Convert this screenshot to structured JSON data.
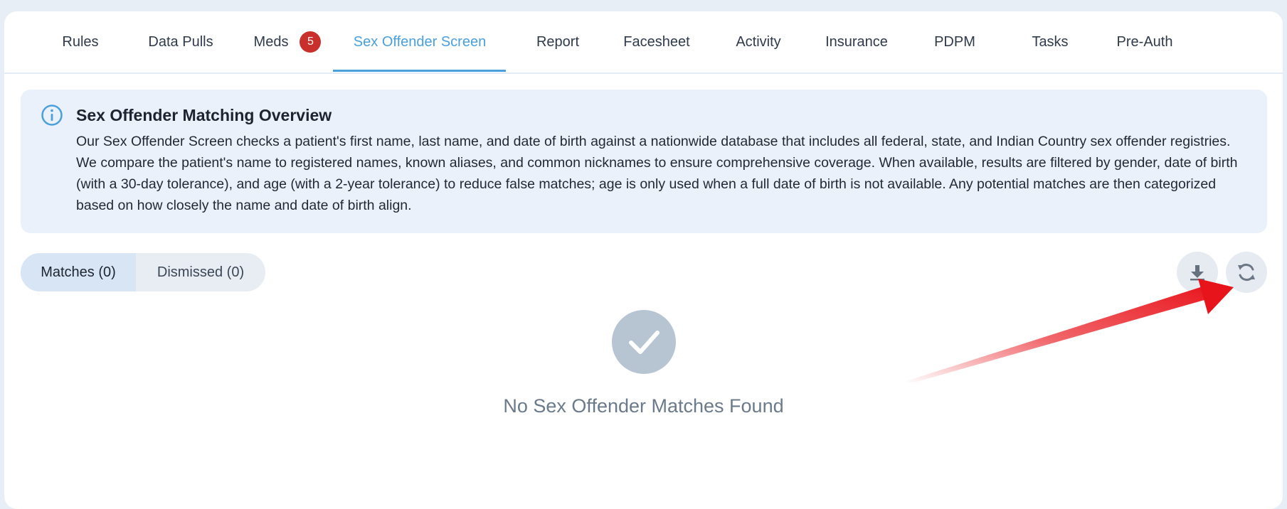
{
  "tabs": [
    {
      "label": "Rules"
    },
    {
      "label": "Data Pulls"
    },
    {
      "label": "Meds",
      "badge": "5"
    },
    {
      "label": "Sex Offender Screen",
      "active": true
    },
    {
      "label": "Report"
    },
    {
      "label": "Facesheet"
    },
    {
      "label": "Activity"
    },
    {
      "label": "Insurance"
    },
    {
      "label": "PDPM"
    },
    {
      "label": "Tasks"
    },
    {
      "label": "Pre-Auth"
    }
  ],
  "info": {
    "icon": "info-circle-icon",
    "title": "Sex Offender Matching Overview",
    "text": "Our Sex Offender Screen checks a patient's first name, last name, and date of birth against a nationwide database that includes all federal, state, and Indian Country sex offender registries. We compare the patient's name to registered names, known aliases, and common nicknames to ensure comprehensive coverage. When available, results are filtered by gender, date of birth (with a 30-day tolerance), and age (with a 2-year tolerance) to reduce false matches; age is only used when a full date of birth is not available. Any potential matches are then categorized based on how closely the name and date of birth align."
  },
  "segments": {
    "matches": "Matches (0)",
    "dismissed": "Dismissed (0)"
  },
  "actions": {
    "download_icon": "download-icon",
    "refresh_icon": "refresh-icon"
  },
  "empty_state": {
    "icon": "check-circle-icon",
    "message": "No Sex Offender Matches Found"
  },
  "colors": {
    "accent": "#4aa0dd",
    "badge": "#c9302c",
    "annotation_arrow": "#e8141b"
  }
}
